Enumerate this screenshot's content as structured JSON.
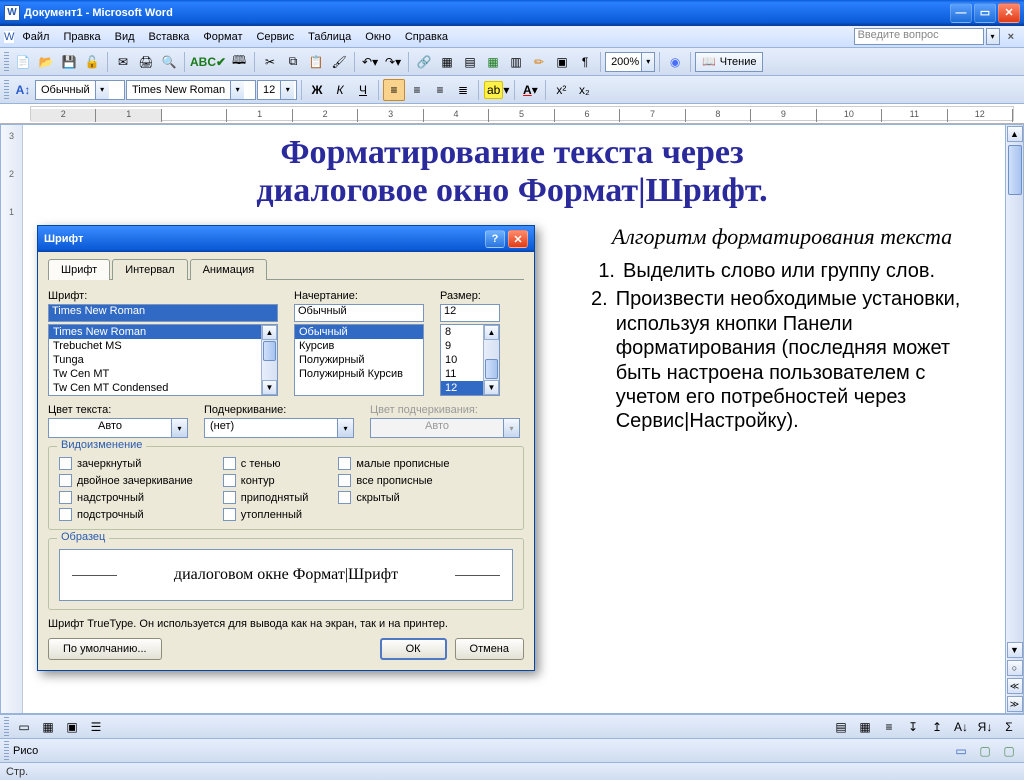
{
  "window": {
    "title": "Документ1 - Microsoft Word",
    "app_icon": "W"
  },
  "menu": {
    "items": [
      "Файл",
      "Правка",
      "Вид",
      "Вставка",
      "Формат",
      "Сервис",
      "Таблица",
      "Окно",
      "Справка"
    ],
    "ask_placeholder": "Введите вопрос"
  },
  "toolbar1": {
    "zoom": "200%",
    "reading": "Чтение"
  },
  "toolbar2": {
    "style": "Обычный",
    "font": "Times New Roman",
    "size": "12"
  },
  "ruler_numbers": [
    "2",
    "1",
    "",
    "1",
    "2",
    "3",
    "4",
    "5",
    "6",
    "7",
    "8",
    "9",
    "10",
    "11",
    "12"
  ],
  "vruler_numbers": [
    "3",
    "2",
    "1"
  ],
  "document": {
    "title_line1": "Форматирование текста через",
    "title_line2": "диалоговое окно Формат|Шрифт.",
    "algo_heading": "Алгоритм форматирования текста",
    "items": [
      {
        "num": "1.",
        "text": "Выделить слово или группу слов."
      },
      {
        "num": "2.",
        "text": "Произвести необходимые установки, используя кнопки Панели форматирования (последняя может быть настроена пользователем с учетом его потребностей через Сервис|Настройку)."
      }
    ]
  },
  "dialog": {
    "title": "Шрифт",
    "tabs": [
      "Шрифт",
      "Интервал",
      "Анимация"
    ],
    "labels": {
      "font": "Шрифт:",
      "style": "Начертание:",
      "size": "Размер:",
      "color": "Цвет текста:",
      "underline": "Подчеркивание:",
      "ul_color": "Цвет подчеркивания:",
      "effects": "Видоизменение",
      "sample": "Образец"
    },
    "font_value": "Times New Roman",
    "font_options": [
      "Times New Roman",
      "Trebuchet MS",
      "Tunga",
      "Tw Cen MT",
      "Tw Cen MT Condensed"
    ],
    "style_value": "Обычный",
    "style_options": [
      "Обычный",
      "Курсив",
      "Полужирный",
      "Полужирный Курсив"
    ],
    "size_value": "12",
    "size_options": [
      "8",
      "9",
      "10",
      "11",
      "12"
    ],
    "color_value": "Авто",
    "underline_value": "(нет)",
    "ul_color_value": "Авто",
    "effects": {
      "col1": [
        "зачеркнутый",
        "двойное зачеркивание",
        "надстрочный",
        "подстрочный"
      ],
      "col2": [
        "с тенью",
        "контур",
        "приподнятый",
        "утопленный"
      ],
      "col3": [
        "малые прописные",
        "все прописные",
        "скрытый"
      ]
    },
    "preview_text": "диалоговом окне Формат|Шрифт",
    "hint": "Шрифт TrueType. Он используется для вывода как на экран, так и на принтер.",
    "btn_defaults": "По умолчанию...",
    "btn_ok": "ОК",
    "btn_cancel": "Отмена"
  },
  "statusbar": {
    "page": "Стр.",
    "draw": "Рисо"
  }
}
